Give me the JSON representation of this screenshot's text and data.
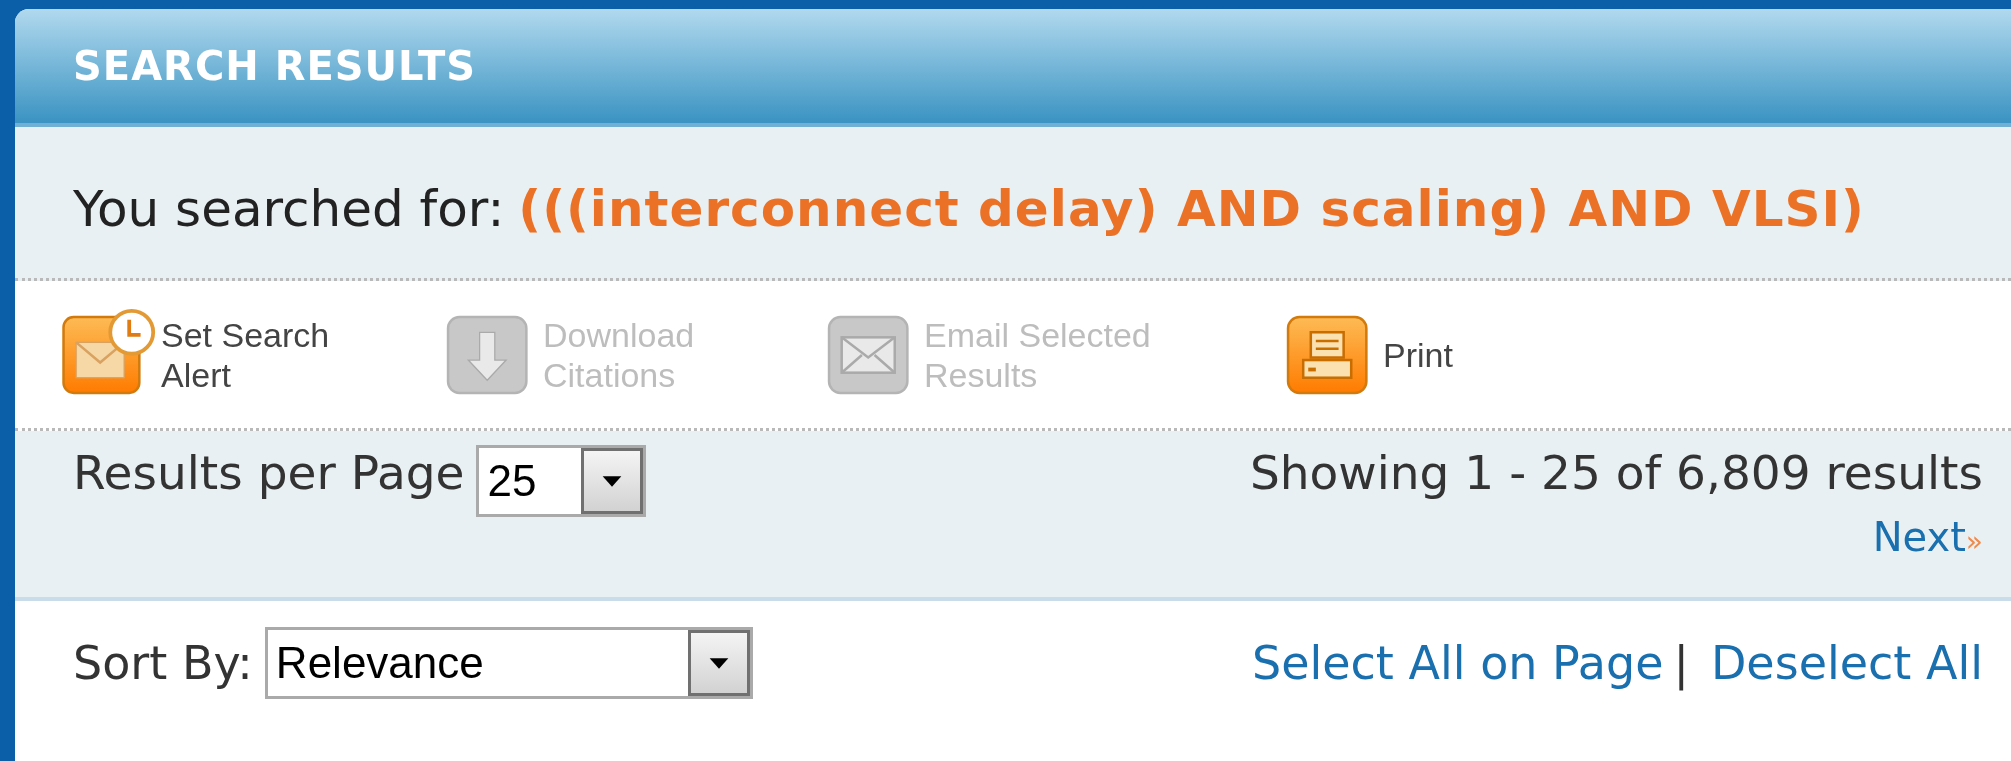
{
  "panel": {
    "title": "SEARCH RESULTS"
  },
  "query": {
    "label": "You searched for:",
    "value": "(((interconnect delay) AND scaling) AND VLSI)"
  },
  "toolbar": [
    {
      "kind": "alert",
      "label": "Set Search Alert",
      "disabled": false
    },
    {
      "kind": "download",
      "label": "Download Citations",
      "disabled": true
    },
    {
      "kind": "email",
      "label": "Email Selected Results",
      "disabled": true
    },
    {
      "kind": "print",
      "label": "Print",
      "disabled": false
    }
  ],
  "paging": {
    "per_page_label": "Results per Page",
    "per_page_value": "25",
    "showing": "Showing 1 - 25 of 6,809 results",
    "next": "Next",
    "next_arrow": "»"
  },
  "sort": {
    "label": "Sort By:",
    "value": "Relevance"
  },
  "selection": {
    "select_all": "Select All on Page",
    "separator": "|",
    "deselect_all": "Deselect All"
  }
}
